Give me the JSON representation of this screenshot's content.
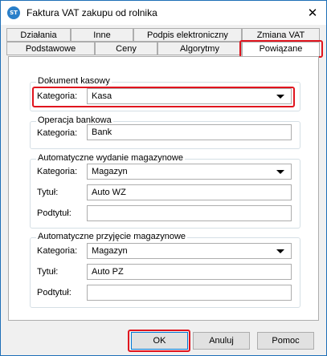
{
  "window": {
    "title": "Faktura VAT zakupu od rolnika",
    "icon": "app-icon",
    "icon_text": "ST",
    "close_glyph": "✕"
  },
  "tabs": {
    "row1": [
      "Działania",
      "Inne",
      "Podpis elektroniczny",
      "Zmiana VAT"
    ],
    "row2": [
      "Podstawowe",
      "Ceny",
      "Algorytmy",
      "Powiązane"
    ],
    "active": "Powiązane"
  },
  "groups": {
    "dokument_kasowy": {
      "title": "Dokument kasowy",
      "kategoria_label": "Kategoria:",
      "kategoria_value": "Kasa"
    },
    "operacja_bankowa": {
      "title": "Operacja bankowa",
      "kategoria_label": "Kategoria:",
      "kategoria_value": "Bank"
    },
    "wydanie": {
      "title": "Automatyczne wydanie magazynowe",
      "kategoria_label": "Kategoria:",
      "kategoria_value": "Magazyn",
      "tytul_label": "Tytuł:",
      "tytul_value": "Auto WZ",
      "podtytul_label": "Podtytuł:",
      "podtytul_value": ""
    },
    "przyjecie": {
      "title": "Automatyczne przyjęcie magazynowe",
      "kategoria_label": "Kategoria:",
      "kategoria_value": "Magazyn",
      "tytul_label": "Tytuł:",
      "tytul_value": "Auto PZ",
      "podtytul_label": "Podtytuł:",
      "podtytul_value": ""
    }
  },
  "buttons": {
    "ok": "OK",
    "cancel": "Anuluj",
    "help": "Pomoc"
  },
  "colors": {
    "highlight": "#e0141e",
    "window_border": "#1e6fb7",
    "dialog_bg": "#f0f0f0"
  }
}
